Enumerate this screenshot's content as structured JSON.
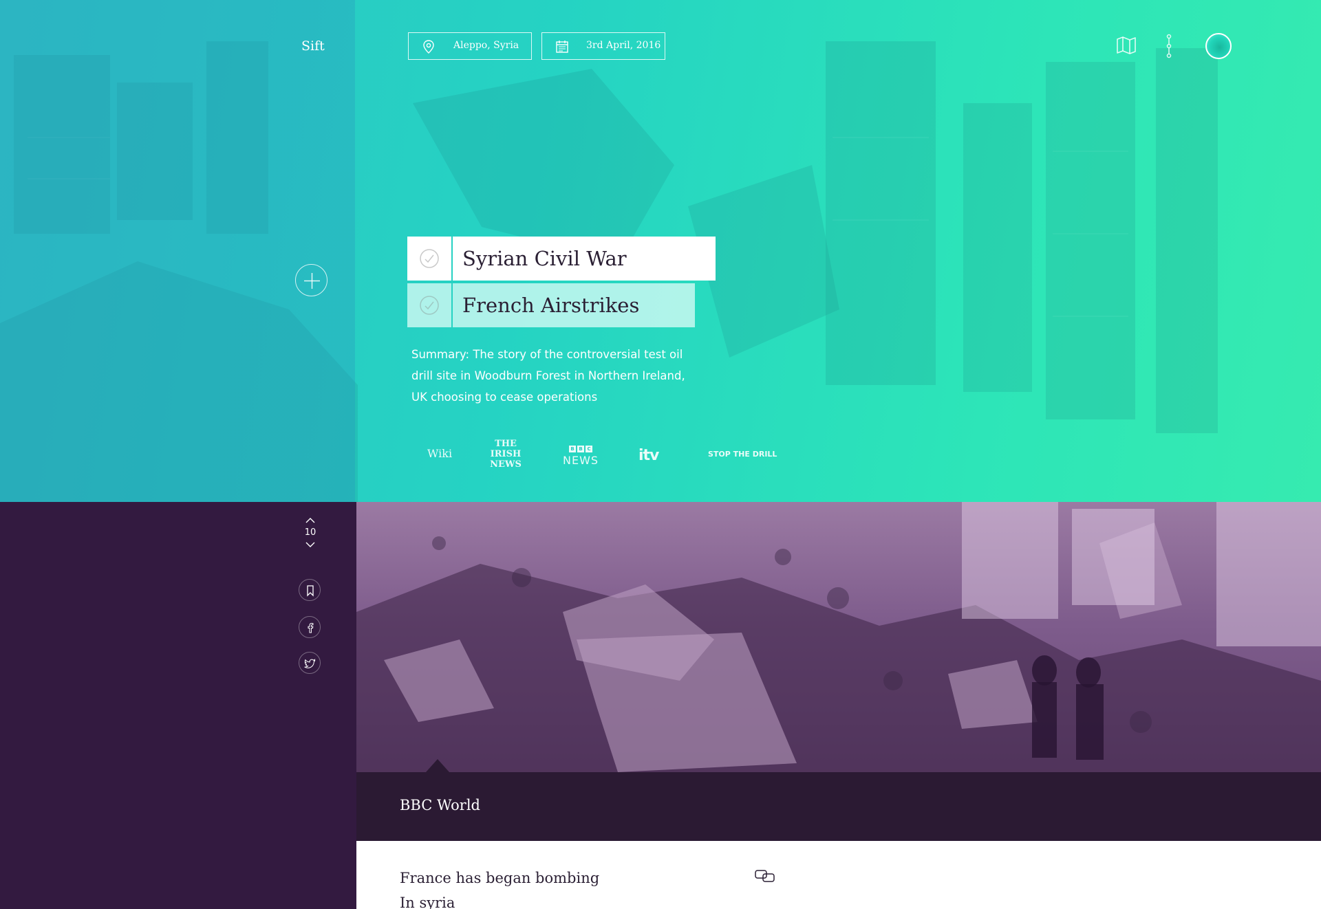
{
  "brand": "Sift",
  "location": {
    "label": "Aleppo, Syria",
    "icon": "location-pin-icon"
  },
  "date": {
    "label": "3rd April, 2016",
    "icon": "calendar-icon"
  },
  "header_icons": [
    "map-icon",
    "more-vertical-icon",
    "profile-avatar"
  ],
  "tags": [
    {
      "label": "Syrian Civil War",
      "icon": "check-circle-icon"
    },
    {
      "label": "French Airstrikes",
      "icon": "check-circle-icon"
    }
  ],
  "summary": "Summary: The story of the controversial test oil drill site in Woodburn Forest in Northern Ireland, UK choosing to cease operations",
  "sources": {
    "wiki": "Wiki",
    "irish_news": [
      "THE",
      "IRISH",
      "NEWS"
    ],
    "bbc": {
      "boxes": [
        "B",
        "B",
        "C"
      ],
      "label": "NEWS"
    },
    "itv": "itv",
    "stop_the_drill": "STOP THE DRILL"
  },
  "counter": {
    "value": "10"
  },
  "side_actions": [
    "bookmark-icon",
    "facebook-icon",
    "twitter-icon"
  ],
  "article": {
    "source_name": "BBC World",
    "headline_line1": "France has began bombing",
    "headline_line2": "In syria"
  },
  "colors": {
    "hero_teal": "#27cbbf",
    "hero_green": "#36ebb0",
    "sidebar_purple": "#331a40",
    "source_bar": "#2b1a33",
    "article_tint": "#7e5c8c"
  }
}
